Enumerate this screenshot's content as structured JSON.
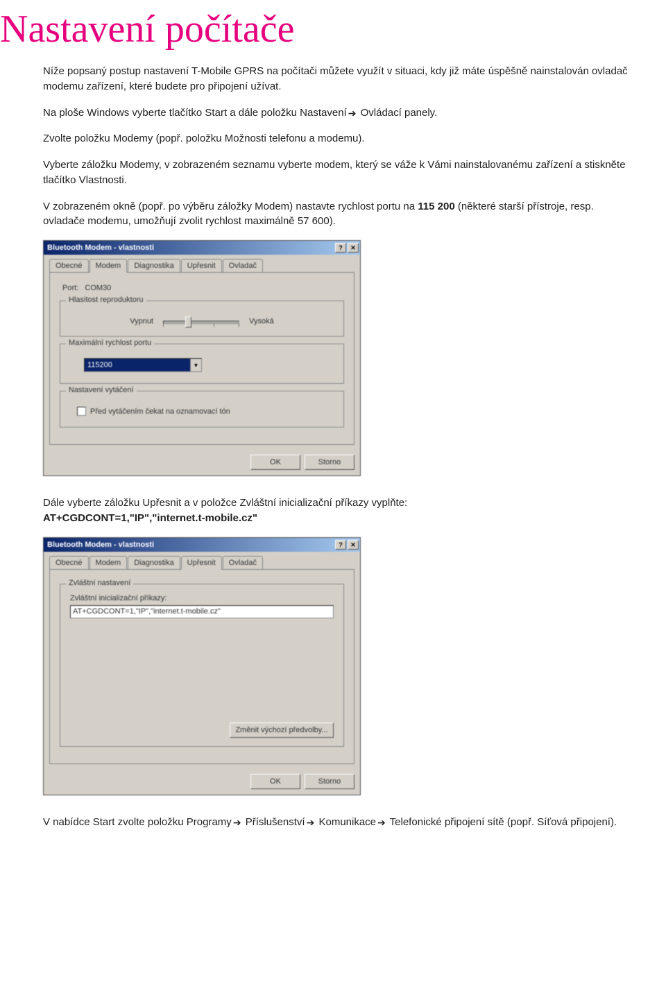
{
  "title": "Nastavení počítače",
  "para1": "Níže popsaný postup nastavení T-Mobile GPRS na počítači můžete využít v situaci, kdy již máte úspěšně nainstalován ovladač modemu zařízení, které budete pro připojení užívat.",
  "para2a": "Na ploše Windows vyberte tlačítko Start a dále položku Nastavení",
  "para2b": " Ovládací panely.",
  "para3": "Zvolte položku Modemy (popř. položku Možnosti telefonu a modemu).",
  "para4": "Vyberte záložku Modemy, v zobrazeném seznamu vyberte modem, který se váže k Vámi nainstalovanému zařízení a stiskněte tlačítko Vlastnosti.",
  "para5": "V zobrazeném okně (popř. po výběru záložky Modem) nastavte rychlost portu na ",
  "para5_bold": "115 200",
  "para5_tail": " (některé starší přístroje, resp. ovladače modemu, umožňují zvolit rychlost maximálně 57 600).",
  "dialog1": {
    "title": "Bluetooth Modem - vlastnosti",
    "tabs": [
      "Obecné",
      "Modem",
      "Diagnostika",
      "Upřesnit",
      "Ovladač"
    ],
    "active_tab": "Modem",
    "port_label": "Port:",
    "port_value": "COM30",
    "group_volume": "Hlasitost reproduktoru",
    "volume_low": "Vypnut",
    "volume_high": "Vysoká",
    "group_speed": "Maximální rychlost portu",
    "speed_value": "115200",
    "group_dial": "Nastavení vytáčení",
    "dial_checkbox": "Před vytáčením čekat na oznamovací tón",
    "ok": "OK",
    "cancel": "Storno"
  },
  "para6a": "Dále vyberte záložku Upřesnit a v položce Zvláštní inicializační příkazy vyplňte:",
  "para6b": "AT+CGDCONT=1,\"IP\",\"internet.t-mobile.cz\"",
  "dialog2": {
    "title": "Bluetooth Modem - vlastnosti",
    "tabs": [
      "Obecné",
      "Modem",
      "Diagnostika",
      "Upřesnit",
      "Ovladač"
    ],
    "active_tab": "Upřesnit",
    "group_extra": "Zvláštní nastavení",
    "field_label": "Zvláštní inicializační příkazy:",
    "field_value": "AT+CGDCONT=1,\"IP\",\"internet.t-mobile.cz\"",
    "change_defaults": "Změnit výchozí předvolby...",
    "ok": "OK",
    "cancel": "Storno"
  },
  "para7_parts": [
    "V nabídce Start zvolte položku Programy",
    " Příslušenství",
    " Komunikace",
    " Telefonické připojení sítě (popř. Síťová připojení)."
  ]
}
